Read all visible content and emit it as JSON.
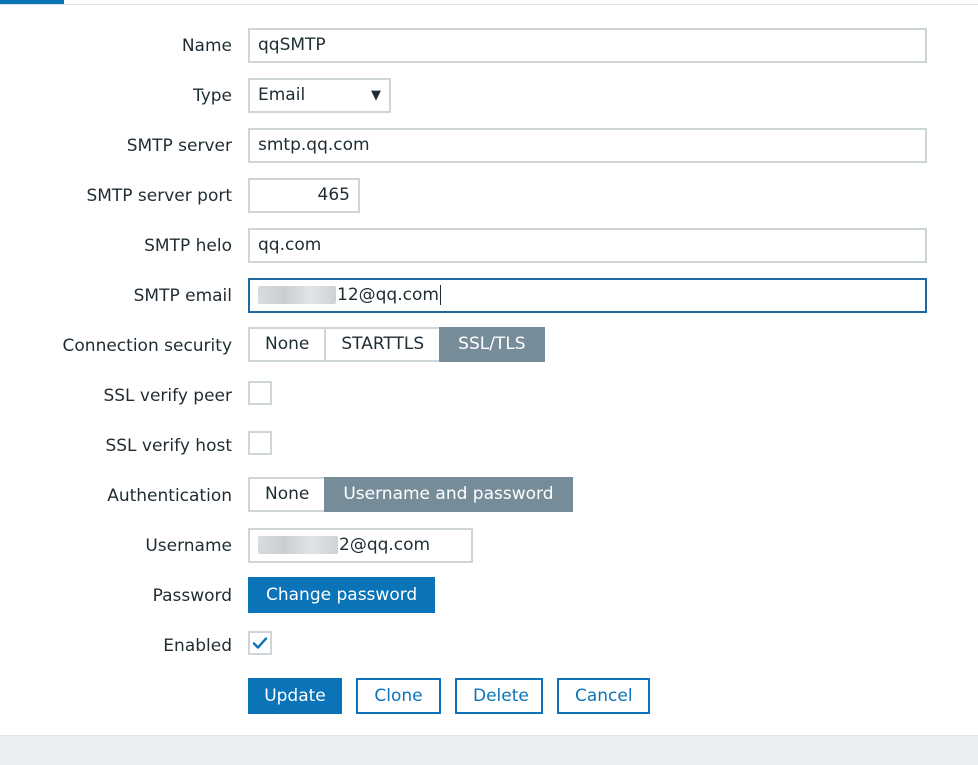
{
  "form": {
    "name": {
      "label": "Name",
      "value": "qqSMTP"
    },
    "type": {
      "label": "Type",
      "selected": "Email"
    },
    "smtp_server": {
      "label": "SMTP server",
      "value": "smtp.qq.com"
    },
    "smtp_server_port": {
      "label": "SMTP server port",
      "value": "465"
    },
    "smtp_helo": {
      "label": "SMTP helo",
      "value": "qq.com"
    },
    "smtp_email": {
      "label": "SMTP email",
      "value_visible": "12@qq.com"
    },
    "connection_security": {
      "label": "Connection security",
      "options": [
        "None",
        "STARTTLS",
        "SSL/TLS"
      ],
      "selected": "SSL/TLS"
    },
    "ssl_verify_peer": {
      "label": "SSL verify peer",
      "checked": false
    },
    "ssl_verify_host": {
      "label": "SSL verify host",
      "checked": false
    },
    "authentication": {
      "label": "Authentication",
      "options": [
        "None",
        "Username and password"
      ],
      "selected": "Username and password"
    },
    "username": {
      "label": "Username",
      "value_visible": "2@qq.com"
    },
    "password": {
      "label": "Password",
      "button": "Change password"
    },
    "enabled": {
      "label": "Enabled",
      "checked": true
    }
  },
  "actions": {
    "update": "Update",
    "clone": "Clone",
    "delete": "Delete",
    "cancel": "Cancel"
  },
  "colors": {
    "primary": "#0b74b8",
    "segment_active": "#768d99",
    "field_border": "#cdd5d9",
    "focus_border": "#1d6aa3"
  },
  "icons": {
    "type_dropdown": "triangle-down-icon",
    "enabled_check": "checkmark-icon"
  }
}
